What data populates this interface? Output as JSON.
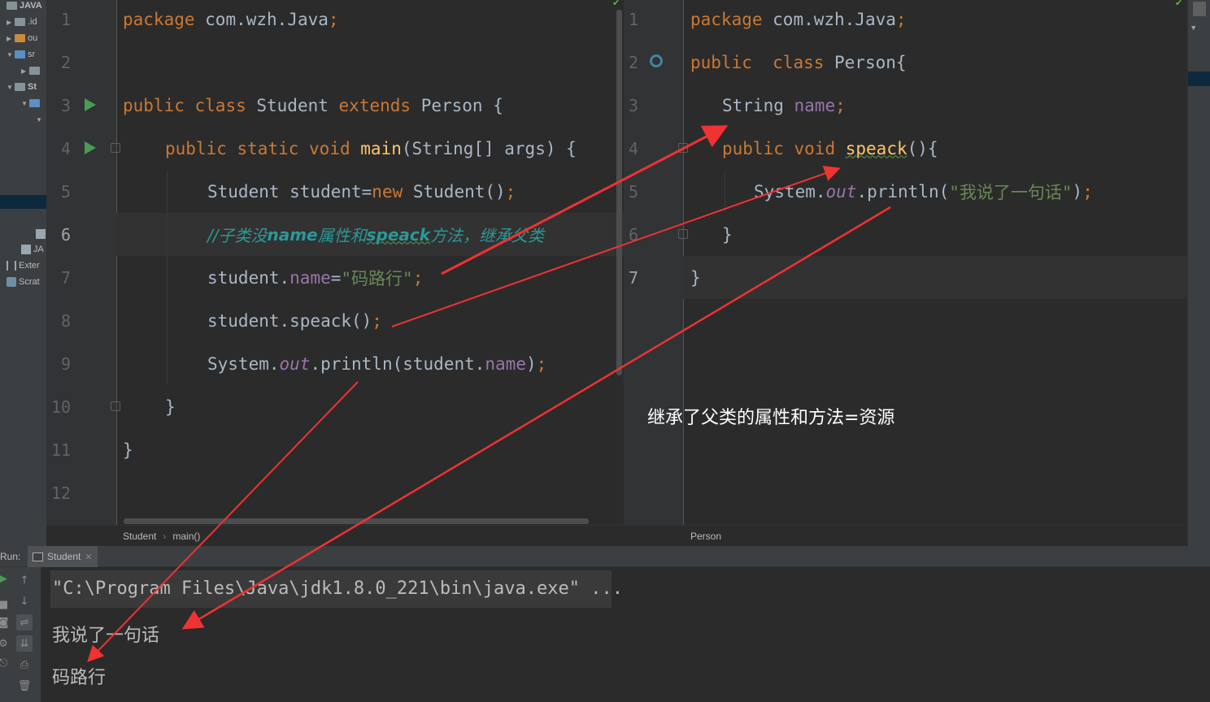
{
  "sidebar": {
    "items": [
      {
        "label": "JAVA"
      },
      {
        "label": ".id"
      },
      {
        "label": "ou"
      },
      {
        "label": "sr"
      },
      {
        "label": ""
      },
      {
        "label": "St"
      },
      {
        "label": ""
      },
      {
        "label": ""
      }
    ],
    "bottom_items": [
      {
        "label": "JA"
      },
      {
        "label": "Exter"
      },
      {
        "label": "Scrat"
      }
    ]
  },
  "left_editor": {
    "lines": [
      {
        "num": "1"
      },
      {
        "num": "2"
      },
      {
        "num": "3"
      },
      {
        "num": "4"
      },
      {
        "num": "5"
      },
      {
        "num": "6"
      },
      {
        "num": "7"
      },
      {
        "num": "8"
      },
      {
        "num": "9"
      },
      {
        "num": "10"
      },
      {
        "num": "11"
      },
      {
        "num": "12"
      }
    ],
    "code": {
      "l1_kw": "package",
      "l1_rest": " com.wzh.Java",
      "l1_semi": ";",
      "l3_kw1": "public",
      "l3_kw2": "class",
      "l3_name": " Student ",
      "l3_kw3": "extends",
      "l3_rest": " Person {",
      "l4_kw1": "public",
      "l4_kw2": "static",
      "l4_kw3": "void",
      "l4_fn": "main",
      "l4_rest": "(String[] args) {",
      "l5_a": "Student student=",
      "l5_kw": "new",
      "l5_b": " Student()",
      "l5_semi": ";",
      "l6_a": "//子类没",
      "l6_b": "name",
      "l6_c": "属性和",
      "l6_d": "speack",
      "l6_e": "方法，继承父类",
      "l7_a": "student.",
      "l7_fld": "name",
      "l7_eq": "=",
      "l7_str": "\"码路行\"",
      "l7_semi": ";",
      "l8_a": "student.speack()",
      "l8_semi": ";",
      "l9_a": "System.",
      "l9_out": "out",
      "l9_b": ".println(student.",
      "l9_fld": "name",
      "l9_c": ")",
      "l9_semi": ";",
      "l10": "}",
      "l11": "}"
    },
    "breadcrumb": [
      "Student",
      "main()"
    ]
  },
  "right_editor": {
    "lines": [
      {
        "num": "1"
      },
      {
        "num": "2"
      },
      {
        "num": "3"
      },
      {
        "num": "4"
      },
      {
        "num": "5"
      },
      {
        "num": "6"
      },
      {
        "num": "7"
      }
    ],
    "code": {
      "l1_kw": "package",
      "l1_rest": " com.wzh.Java",
      "l1_semi": ";",
      "l2_kw1": "public",
      "l2_kw2": "class",
      "l2_rest": " Person{",
      "l3_type": "String ",
      "l3_fld": "name",
      "l3_semi": ";",
      "l4_kw1": "public",
      "l4_kw2": "void",
      "l4_fn": "speack",
      "l4_rest": "(){",
      "l5_a": "System.",
      "l5_out": "out",
      "l5_b": ".println(",
      "l5_str": "\"我说了一句话\"",
      "l5_c": ")",
      "l5_semi": ";",
      "l6": "}",
      "l7": "}"
    },
    "breadcrumb": [
      "Person"
    ]
  },
  "run_panel": {
    "label": "Run:",
    "tab": "Student",
    "output": [
      "\"C:\\Program Files\\Java\\jdk1.8.0_221\\bin\\java.exe\" ...",
      "我说了一句话",
      "码路行"
    ]
  },
  "annotation": "继承了父类的属性和方法=资源",
  "colors": {
    "keyword": "#cc7832",
    "field": "#9876aa",
    "string": "#6a8759",
    "comment": "#629755",
    "arrow": "#f03232"
  },
  "icons": [
    "folder-icon",
    "run-icon",
    "fold-icon",
    "override-icon",
    "check-icon",
    "up-icon",
    "down-icon",
    "wrap-icon",
    "scroll-end-icon",
    "print-icon",
    "trash-icon"
  ]
}
